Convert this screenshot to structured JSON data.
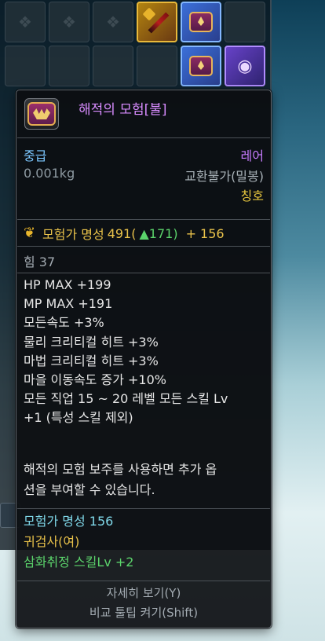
{
  "inventory": {
    "icons": [
      "decor-shape-icon",
      "sword-icon",
      "emblem-icon",
      "emblem-icon",
      "orb-icon"
    ]
  },
  "tooltip": {
    "item_name": "해적의 모험[불]",
    "grade": "중급",
    "rarity": "레어",
    "weight": "0.001kg",
    "trade": "교환불가(밀봉)",
    "kind": "칭호",
    "fame": {
      "label": "모험가 명성",
      "value": "491(",
      "arrow": "▲171)",
      "bonus": "+ 156"
    },
    "strength": "힘 37",
    "stats": [
      "HP MAX +199",
      "MP MAX +191",
      "모든속도 +3%",
      "물리 크리티컬 히트 +3%",
      "마법 크리티컬 히트 +3%",
      "마을 이동속도 증가 +10%",
      "모든 직업 15 ~ 20 레벨 모든 스킬 Lv",
      "+1 (특성 스킬 제외)"
    ],
    "description": [
      "해적의 모험 보주를 사용하면 추가 옵",
      "션을 부여할 수 있습니다."
    ],
    "set": {
      "fame": "모험가 명성 156",
      "class": "귀검사(여)",
      "skill": "삼화취정 스킬Lv +2"
    },
    "footer": {
      "details": "자세히 보기(Y)",
      "compare": "비교 툴팁 켜기(Shift)"
    }
  }
}
